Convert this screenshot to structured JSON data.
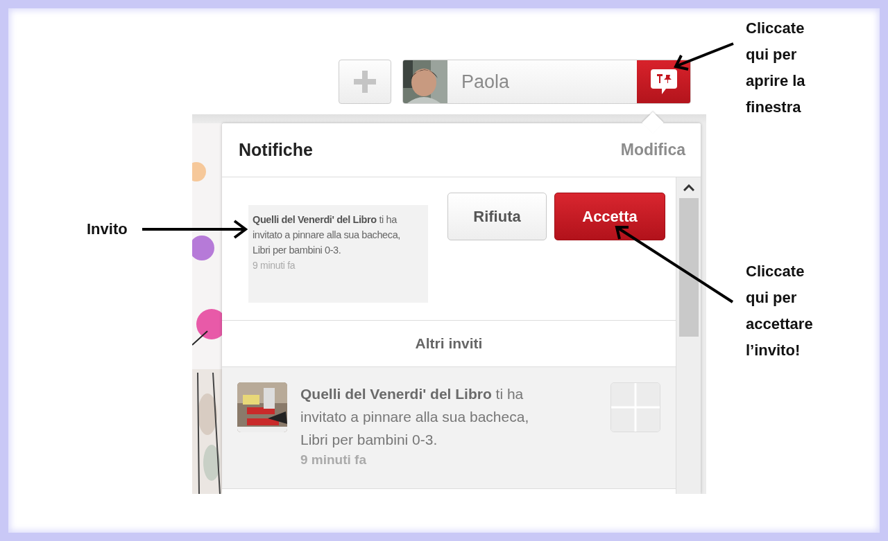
{
  "toolbar": {
    "user_name": "Paola"
  },
  "notifications": {
    "title": "Notifiche",
    "edit_link": "Modifica",
    "invite": {
      "message": "**Quelli del Venerdi' del Libro** ti ha invitato a pinnare alla sua bacheca, Libri per bambini 0-3.",
      "time": "9 minuti fa",
      "buttons": [
        {
          "label": "Rifiuta",
          "kind": "secondary"
        },
        {
          "label": "Accetta",
          "kind": "primary"
        }
      ]
    },
    "section_title": "Altri inviti",
    "other_invites": [
      {
        "message": "**Quelli del Venerdi' del Libro** ti ha invitato a pinnare alla sua bacheca, Libri per bambini 0-3.",
        "time": "9 minuti fa"
      }
    ]
  },
  "annotations": [
    {
      "text": "Invito",
      "kind": "left"
    },
    {
      "text": "Cliccate qui per aprire la finestra",
      "kind": "top"
    },
    {
      "text": "Cliccate qui per accettare l’invito!",
      "kind": "bottom"
    }
  ]
}
